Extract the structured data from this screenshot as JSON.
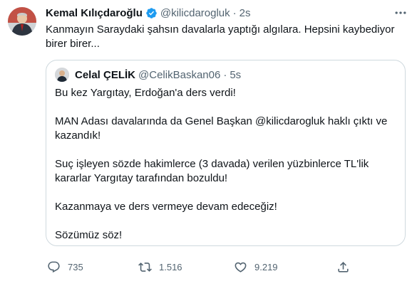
{
  "tweet": {
    "author": {
      "name": "Kemal Kılıçdaroğlu",
      "handle": "@kilicdarogluk",
      "time": "2s"
    },
    "text": "Kanmayın Saraydaki şahsın davalarla yaptığı algılara. Hepsini kaybediyor\nbirer birer...",
    "quote": {
      "author": {
        "name": "Celal ÇELİK",
        "handle": "@CelikBaskan06",
        "time": "5s"
      },
      "paragraphs": [
        "Bu kez Yargıtay, Erdoğan'a ders verdi!",
        "MAN Adası davalarında da Genel Başkan @kilicdarogluk haklı çıktı ve kazandık!",
        "Suç işleyen sözde hakimlerce (3 davada) verilen yüzbinlerce TL'lik kararlar Yargıtay tarafından bozuldu!",
        "Kazanmaya ve ders vermeye devam edeceğiz!",
        "Sözümüz söz!"
      ]
    },
    "actions": {
      "reply_count": "735",
      "retweet_count": "1.516",
      "like_count": "9.219"
    },
    "colors": {
      "verified": "#1d9bf0",
      "muted": "#536471",
      "border": "#cfd9de"
    }
  }
}
